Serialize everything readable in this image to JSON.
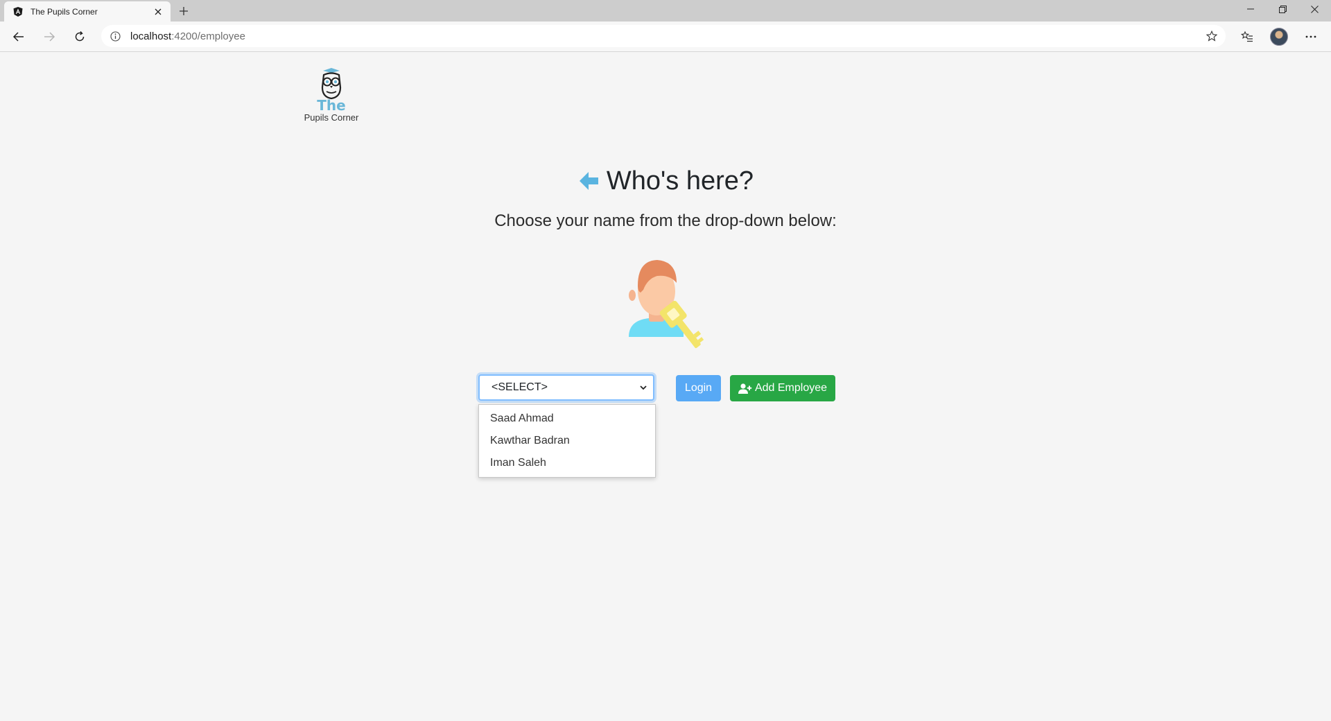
{
  "browser": {
    "tab_title": "The Pupils Corner",
    "url_host": "localhost",
    "url_path": ":4200/employee",
    "icons": {
      "favicon": "angular-icon",
      "close": "close-icon",
      "new_tab": "plus-icon",
      "back": "back-arrow-icon",
      "forward": "forward-arrow-icon",
      "refresh": "refresh-icon",
      "info": "info-icon",
      "favorite": "star-icon",
      "favorites_bar": "favorites-icon",
      "profile": "avatar",
      "menu": "more-icon"
    }
  },
  "logo": {
    "line1": "The",
    "line2": "Pupils Corner",
    "accent_color": "#6ab7d8"
  },
  "heading": {
    "title": "Who's here?",
    "subtitle": "Choose your name from the drop-down below:",
    "arrow_color": "#5ab4e0"
  },
  "employee_select": {
    "selected": "<SELECT>",
    "options": [
      "Saad Ahmad",
      "Kawthar Badran",
      "Iman Saleh"
    ]
  },
  "buttons": {
    "login": "Login",
    "add_employee": "Add Employee",
    "login_color": "#58a9f5",
    "add_color": "#28a745"
  }
}
